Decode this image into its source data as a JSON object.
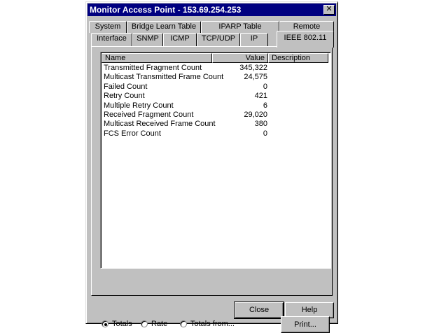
{
  "window": {
    "title": "Monitor Access Point - 153.69.254.253"
  },
  "tabs_back": [
    "System",
    "Bridge Learn Table",
    "IPARP Table",
    "Remote"
  ],
  "tabs_front": [
    "Interface",
    "SNMP",
    "ICMP",
    "TCP/UDP",
    "IP",
    "IEEE 802.11"
  ],
  "selected_tab": "IEEE 802.11",
  "list": {
    "columns": [
      "Name",
      "Value",
      "Description"
    ],
    "rows": [
      {
        "name": "Transmitted Fragment Count",
        "value": "345,322",
        "description": ""
      },
      {
        "name": "Multicast Transmitted Frame Count",
        "value": "24,575",
        "description": ""
      },
      {
        "name": "Failed Count",
        "value": "0",
        "description": ""
      },
      {
        "name": "Retry Count",
        "value": "421",
        "description": ""
      },
      {
        "name": "Multiple Retry Count",
        "value": "6",
        "description": ""
      },
      {
        "name": "Received Fragment Count",
        "value": "29,020",
        "description": ""
      },
      {
        "name": "Multicast Received Frame Count",
        "value": "380",
        "description": ""
      },
      {
        "name": "FCS Error Count",
        "value": "0",
        "description": ""
      }
    ]
  },
  "radios": {
    "selected": "totals",
    "options": [
      {
        "id": "totals",
        "label": "Totals"
      },
      {
        "id": "rate",
        "label": "Rate"
      },
      {
        "id": "totals_from",
        "label": "Totals from..."
      }
    ]
  },
  "buttons": {
    "print": "Print...",
    "close": "Close",
    "help": "Help"
  }
}
